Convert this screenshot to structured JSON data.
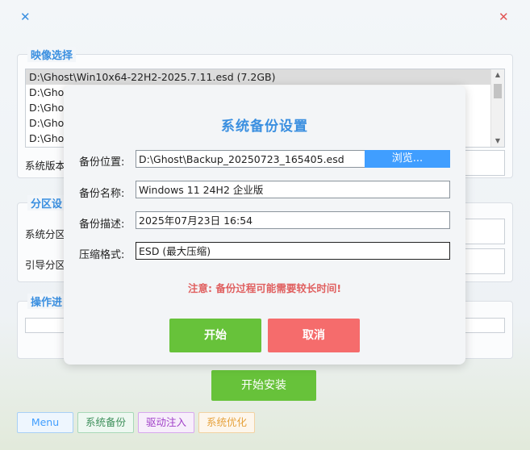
{
  "titlebar": {
    "left_icon": "close-x-blue",
    "right_icon": "close-x-red"
  },
  "image_group": {
    "title": "映像选择",
    "list_items": [
      "D:\\Ghost\\Win10x64-22H2-2025.7.11.esd (7.2GB)",
      "D:\\Ghos",
      "D:\\Ghos",
      "D:\\Ghos",
      "D:\\Ghos"
    ],
    "version_label": "系统版本"
  },
  "partition_group": {
    "title": "分区设",
    "system_label": "系统分区",
    "boot_label": "引导分区"
  },
  "progress_group": {
    "title": "操作进"
  },
  "main_button": "开始安装",
  "tabs": [
    {
      "label": "Menu",
      "color": "#409eff"
    },
    {
      "label": "系统备份",
      "color": "#3d8f5a"
    },
    {
      "label": "驱动注入",
      "color": "#a040c8"
    },
    {
      "label": "系统优化",
      "color": "#e6a23c"
    }
  ],
  "dialog": {
    "title": "系统备份设置",
    "location_label": "备份位置:",
    "location_value": "D:\\Ghost\\Backup_20250723_165405.esd",
    "browse_label": "浏览...",
    "name_label": "备份名称:",
    "name_value": "Windows 11 24H2 企业版",
    "desc_label": "备份描述:",
    "desc_value": "2025年07月23日 16:54",
    "format_label": "压缩格式:",
    "format_value": "ESD (最大压缩)",
    "warning": "注意: 备份过程可能需要较长时间!",
    "start_label": "开始",
    "cancel_label": "取消",
    "start_color": "#67c23a",
    "cancel_color": "#f56c6c"
  }
}
